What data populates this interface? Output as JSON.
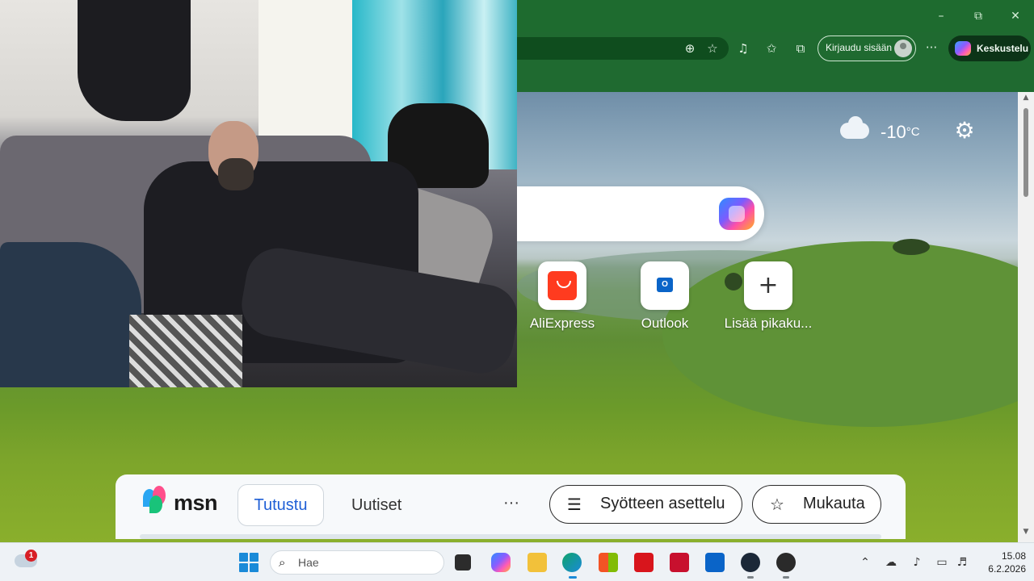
{
  "browser": {
    "toolbar": {
      "signin_label": "Kirjaudu sisään",
      "chat_label": "Keskustelu",
      "more_label": "···"
    },
    "window_controls": {
      "minimize": "–",
      "restore": "⧉",
      "close": "✕"
    }
  },
  "newtab": {
    "weather": {
      "temperature": "-10",
      "unit": "°C"
    },
    "quick_links": [
      {
        "label": "AliExpress",
        "icon": "aliexpress-icon"
      },
      {
        "label": "Outlook",
        "icon": "outlook-icon"
      },
      {
        "label": "Lisää pikaku...",
        "icon": "plus-icon"
      }
    ],
    "outlook_glyph": "O"
  },
  "msn": {
    "brand": "msn",
    "tabs": [
      {
        "label": "Tutustu",
        "active": true
      },
      {
        "label": "Uutiset",
        "active": false
      }
    ],
    "more_label": "···",
    "layout_button": "Syötteen asettelu",
    "customize_button": "Mukauta"
  },
  "taskbar": {
    "weather_badge": "1",
    "search_placeholder": "Hae",
    "clock": {
      "time": "15.08",
      "date": "6.2.2026"
    }
  },
  "colors": {
    "edge_theme": "#1f6a30",
    "msn_active_tab": "#1f5fd6",
    "badge": "#d81f26"
  }
}
